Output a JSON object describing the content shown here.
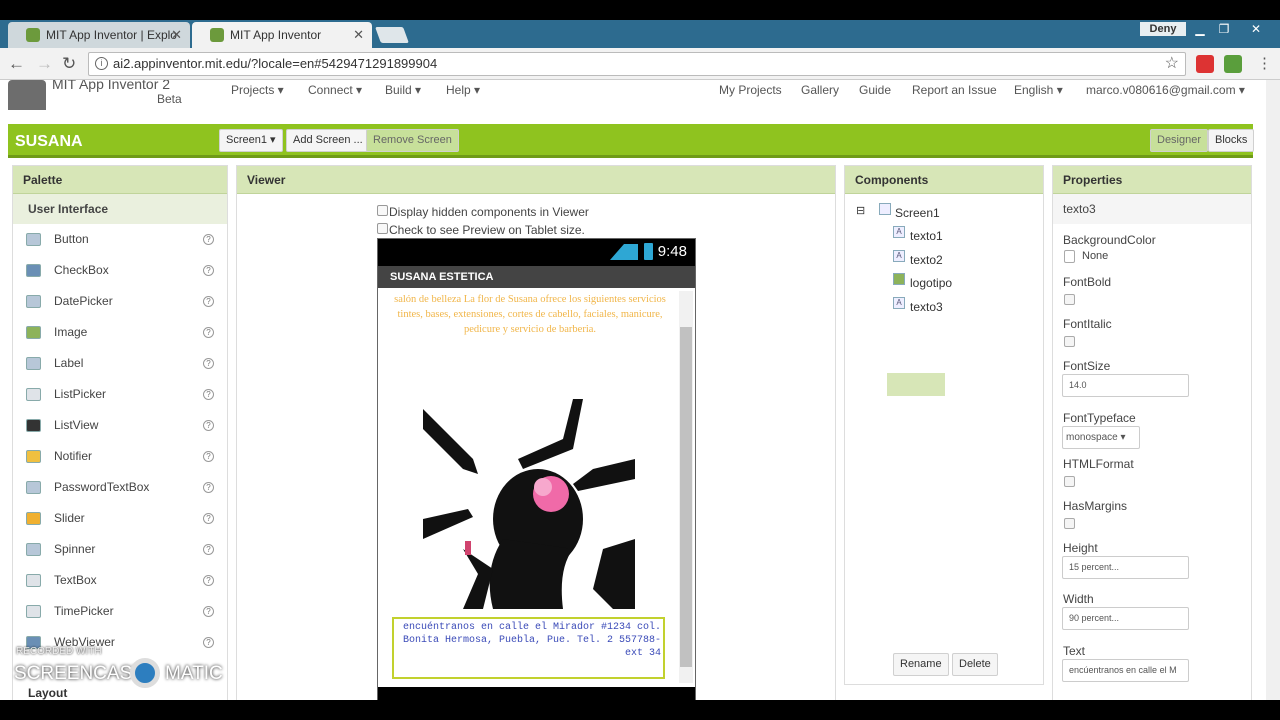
{
  "browser": {
    "tabs": [
      {
        "title": "MIT App Inventor | Explo"
      },
      {
        "title": "MIT App Inventor"
      }
    ],
    "profile": "Deny",
    "url": "ai2.appinventor.mit.edu/?locale=en#5429471291899904"
  },
  "header": {
    "app_title": "MIT App Inventor 2",
    "beta": "Beta",
    "menu": [
      "Projects ▾",
      "Connect ▾",
      "Build ▾",
      "Help ▾"
    ],
    "right_links": [
      "My Projects",
      "Gallery",
      "Guide",
      "Report an Issue",
      "English ▾",
      "marco.v080616@gmail.com ▾"
    ]
  },
  "project": {
    "name": "SUSANA",
    "screen_select": "Screen1 ▾",
    "add_screen": "Add Screen ...",
    "remove_screen": "Remove Screen",
    "designer": "Designer",
    "blocks": "Blocks"
  },
  "palette": {
    "title": "Palette",
    "category": "User Interface",
    "items": [
      "Button",
      "CheckBox",
      "DatePicker",
      "Image",
      "Label",
      "ListPicker",
      "ListView",
      "Notifier",
      "PasswordTextBox",
      "Slider",
      "Spinner",
      "TextBox",
      "TimePicker",
      "WebViewer"
    ],
    "next_category": "Layout",
    "help": "?"
  },
  "viewer": {
    "title": "Viewer",
    "opt_hidden": "Display hidden components in Viewer",
    "opt_tablet": "Check to see Preview on Tablet size.",
    "phone": {
      "time": "9:48",
      "app_bar": "SUSANA ESTETICA",
      "texto1": "salón de belleza La flor de Susana ofrece los siguientes servicios tintes, bases, extensiones, cortes de cabello, faciales, manicure, pedicure y servicio de barberia.",
      "texto3": "encuéntranos en calle el Mirador #1234 col. Bonita Hermosa, Puebla, Pue. Tel. 2 557788- ext 34"
    }
  },
  "components": {
    "title": "Components",
    "tree": [
      "Screen1",
      "texto1",
      "texto2",
      "logotipo",
      "texto3"
    ],
    "rename": "Rename",
    "delete": "Delete"
  },
  "properties": {
    "title": "Properties",
    "selected": "texto3",
    "background_color_label": "BackgroundColor",
    "background_color_value": "None",
    "fontbold_label": "FontBold",
    "fontitalic_label": "FontItalic",
    "fontsize_label": "FontSize",
    "fontsize_value": "14.0",
    "fonttypeface_label": "FontTypeface",
    "fonttypeface_value": "monospace ▾",
    "htmlformat_label": "HTMLFormat",
    "hasmargins_label": "HasMargins",
    "height_label": "Height",
    "height_value": "15 percent...",
    "width_label": "Width",
    "width_value": "90 percent...",
    "text_label": "Text",
    "text_value": "encúentranos en calle el M"
  },
  "watermark": {
    "recorded": "RECORDED WITH",
    "brand_a": "SCREENCAST",
    "brand_b": "MATIC"
  },
  "colors": {
    "accent": "#8fc31f",
    "panel_header": "#d7e6b7",
    "texto1": "#f1b64a",
    "texto3": "#3b4bb8"
  }
}
